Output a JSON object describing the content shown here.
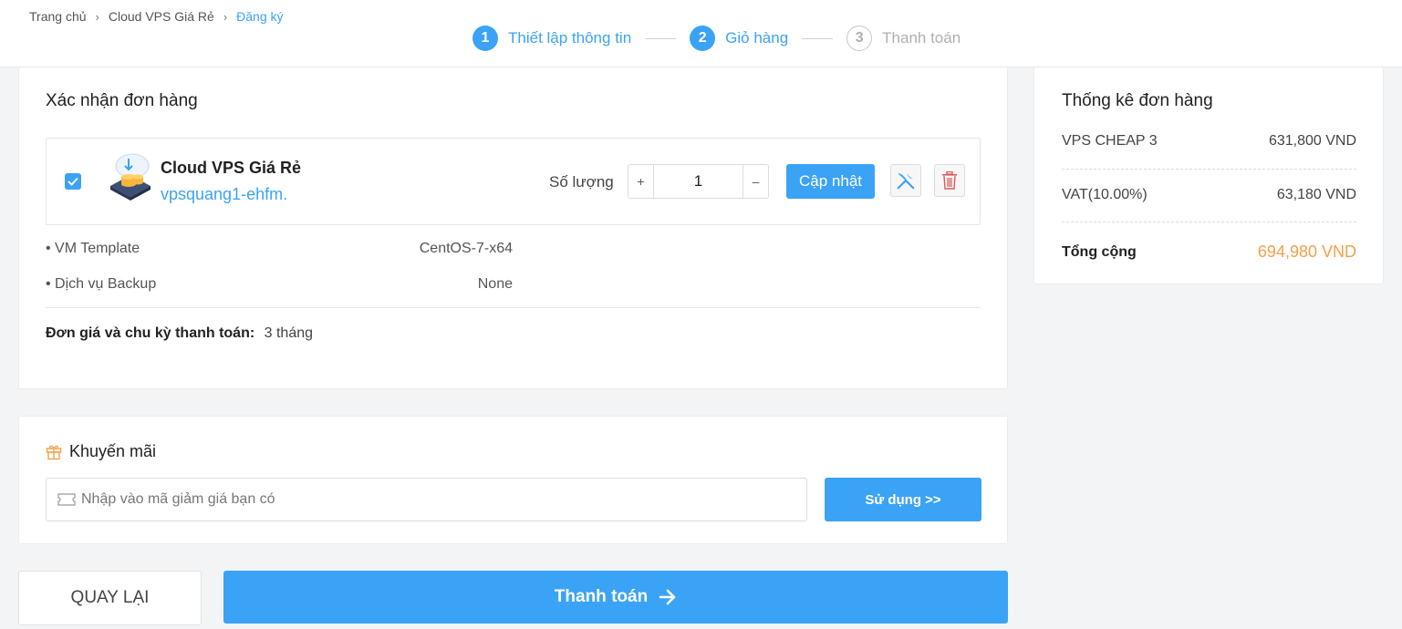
{
  "breadcrumb": {
    "items": [
      "Trang chủ",
      "Cloud VPS Giá Rẻ"
    ],
    "current": "Đăng ký"
  },
  "steps": [
    {
      "num": "1",
      "label": "Thiết lập thông tin",
      "state": "active"
    },
    {
      "num": "2",
      "label": "Giỏ hàng",
      "state": "active"
    },
    {
      "num": "3",
      "label": "Thanh toán",
      "state": "inactive"
    }
  ],
  "order": {
    "title": "Xác nhận đơn hàng",
    "product_name": "Cloud VPS Giá Rẻ",
    "hostname": "vpsquang1-ehfm.",
    "qty_label": "Số lượng",
    "qty_plus": "+",
    "qty_minus": "–",
    "quantity": "1",
    "update_label": "Cập nhật",
    "specs": [
      {
        "label": "• VM Template",
        "value": "CentOS-7-x64"
      },
      {
        "label": "• Dịch vụ Backup",
        "value": "None"
      }
    ],
    "cycle_label": "Đơn giá và chu kỳ thanh toán:",
    "cycle_value": "3 tháng"
  },
  "promo": {
    "title": "Khuyến mãi",
    "placeholder": "Nhập vào mã giảm giá bạn có",
    "use_label": "Sử dụng >>"
  },
  "actions": {
    "back_label": "QUAY LẠI",
    "pay_label": "Thanh toán"
  },
  "summary": {
    "title": "Thống kê đơn hàng",
    "rows": [
      {
        "label": "VPS CHEAP 3",
        "value": "631,800 VND"
      },
      {
        "label": "VAT(10.00%)",
        "value": "63,180 VND"
      }
    ],
    "total_label": "Tổng cộng",
    "total_value": "694,980 VND"
  },
  "colors": {
    "accent": "#3ba3f5",
    "total": "#f5a04a",
    "delete": "#e05a5a"
  }
}
